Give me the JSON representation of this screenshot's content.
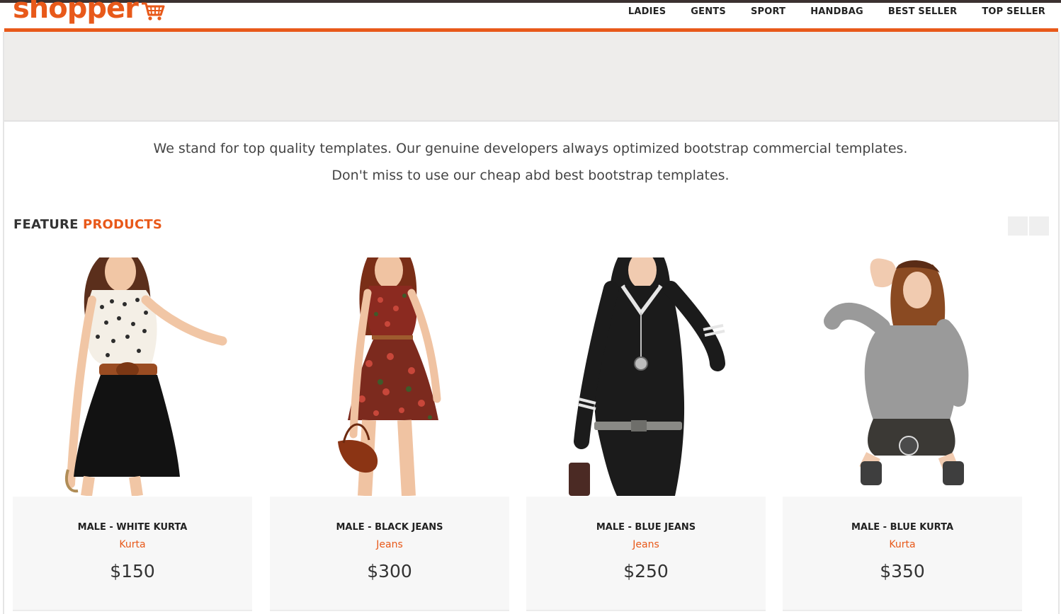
{
  "brand": {
    "name": "shopper",
    "color": "#e8591a"
  },
  "nav": {
    "items": [
      {
        "label": "LADIES"
      },
      {
        "label": "GENTS"
      },
      {
        "label": "SPORT"
      },
      {
        "label": "HANDBAG"
      },
      {
        "label": "BEST SELLER"
      },
      {
        "label": "TOP SELLER"
      }
    ]
  },
  "intro": {
    "line1": "We stand for top quality templates. Our genuine developers always optimized bootstrap commercial templates.",
    "line2": "Don't miss to use our cheap abd best bootstrap templates."
  },
  "featured": {
    "title_word1": "FEATURE",
    "title_word2": "PRODUCTS",
    "controls": [
      "chevron-left-icon",
      "chevron-right-icon"
    ]
  },
  "products": [
    {
      "name": "MALE - WHITE KURTA",
      "category": "Kurta",
      "price": "$150"
    },
    {
      "name": "MALE - BLACK JEANS",
      "category": "Jeans",
      "price": "$300"
    },
    {
      "name": "MALE - BLUE JEANS",
      "category": "Jeans",
      "price": "$250"
    },
    {
      "name": "MALE - BLUE KURTA",
      "category": "Kurta",
      "price": "$350"
    }
  ],
  "colors": {
    "accent": "#e8591a",
    "banner": "#eeedeb",
    "card_info": "#f7f7f7",
    "top_rule": "#3b3130"
  }
}
